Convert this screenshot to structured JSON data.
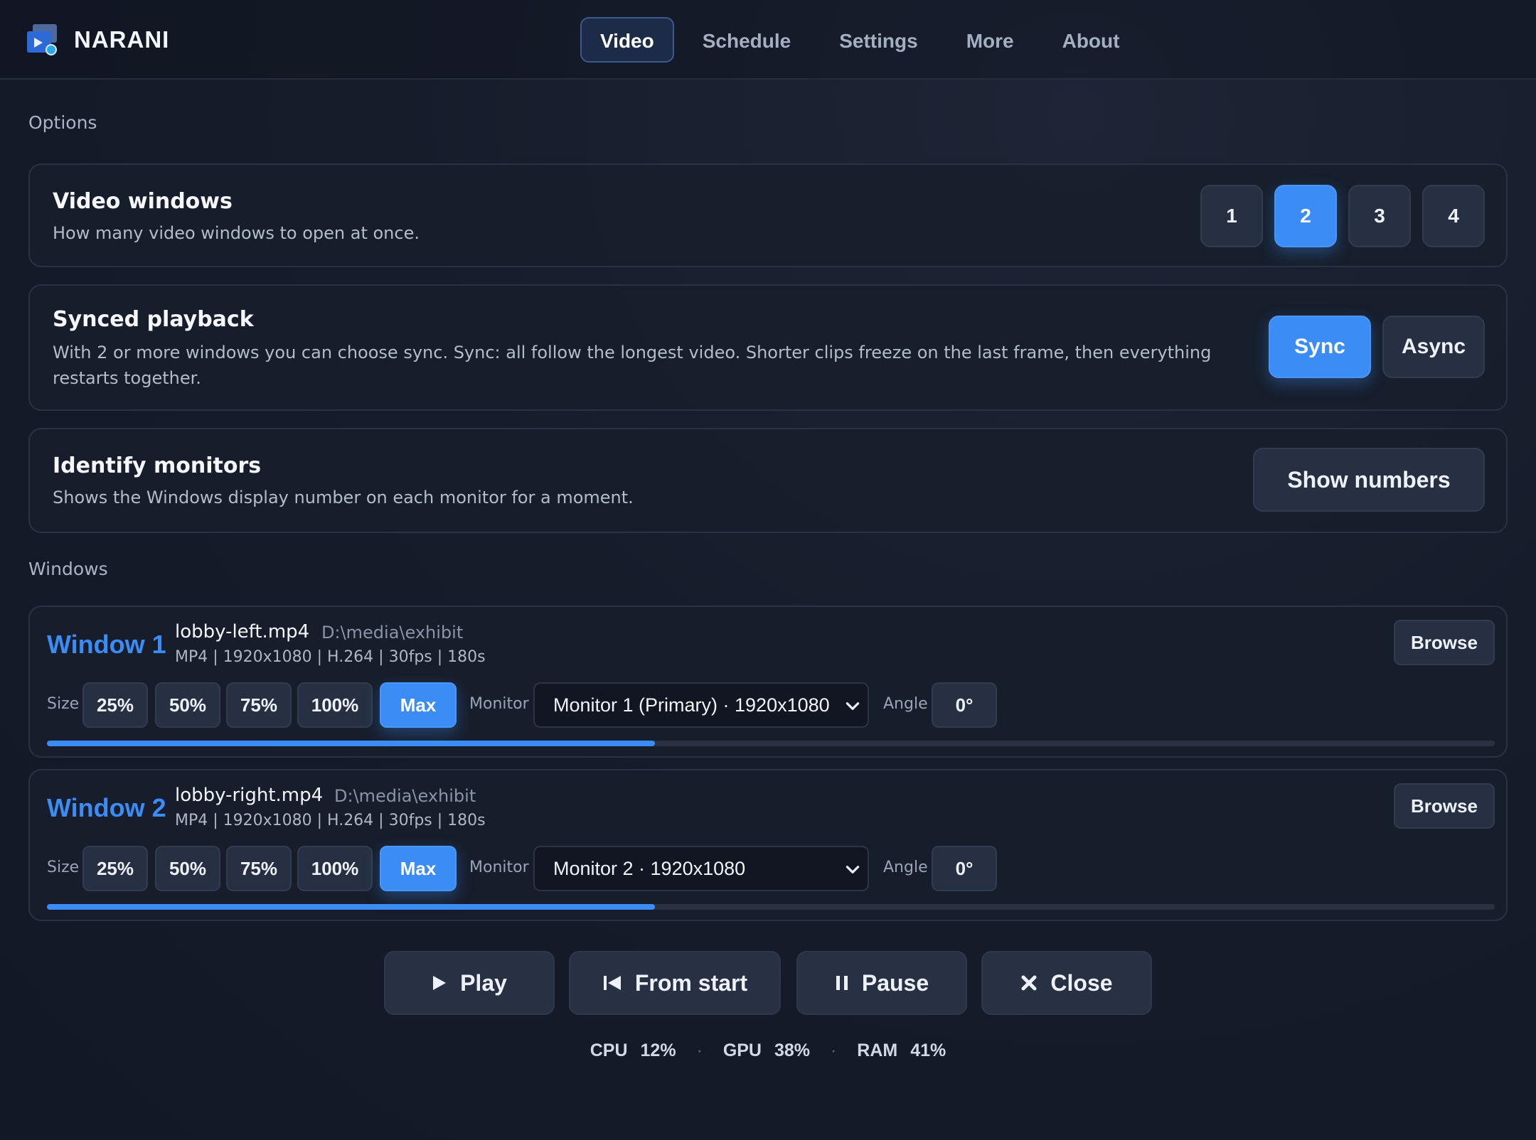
{
  "app": {
    "name": "NARANI"
  },
  "nav": {
    "tabs": [
      "Video",
      "Schedule",
      "Settings",
      "More",
      "About"
    ],
    "active": "Video"
  },
  "options": {
    "section_label": "Options",
    "video_windows": {
      "title": "Video windows",
      "desc": "How many video windows to open at once.",
      "choices": [
        "1",
        "2",
        "3",
        "4"
      ],
      "selected": "2"
    },
    "synced_playback": {
      "title": "Synced playback",
      "desc": "With 2 or more windows you can choose sync. Sync: all follow the longest video. Shorter clips freeze on the last frame, then everything restarts together.",
      "sync_label": "Sync",
      "async_label": "Async",
      "selected": "Sync"
    },
    "identify_monitors": {
      "title": "Identify monitors",
      "desc": "Shows the Windows display number on each monitor for a moment.",
      "button": "Show numbers"
    }
  },
  "windows_section": {
    "label": "Windows",
    "size_label": "Size",
    "monitor_label": "Monitor",
    "angle_label": "Angle",
    "browse_label": "Browse",
    "sizes": [
      "25%",
      "50%",
      "75%",
      "100%",
      "Max"
    ],
    "items": [
      {
        "title": "Window 1",
        "file": "lobby-left.mp4",
        "path": "D:\\media\\exhibit",
        "meta": "MP4 | 1920x1080 | H.264 | 30fps | 180s",
        "size_selected": "Max",
        "monitor": "Monitor 1 (Primary) · 1920x1080",
        "angle": "0°",
        "progress": 0.42
      },
      {
        "title": "Window 2",
        "file": "lobby-right.mp4",
        "path": "D:\\media\\exhibit",
        "meta": "MP4 | 1920x1080 | H.264 | 30fps | 180s",
        "size_selected": "Max",
        "monitor": "Monitor 2 · 1920x1080",
        "angle": "0°",
        "progress": 0.42
      }
    ]
  },
  "controls": {
    "play": "Play",
    "from_start": "From start",
    "pause": "Pause",
    "close": "Close"
  },
  "stats": {
    "cpu_label": "CPU",
    "cpu": "12%",
    "gpu_label": "GPU",
    "gpu": "38%",
    "ram_label": "RAM",
    "ram": "41%",
    "separator": "·"
  },
  "colors": {
    "accent": "#3b8cf5",
    "background": "#161c2a",
    "card": "#181e2b"
  }
}
